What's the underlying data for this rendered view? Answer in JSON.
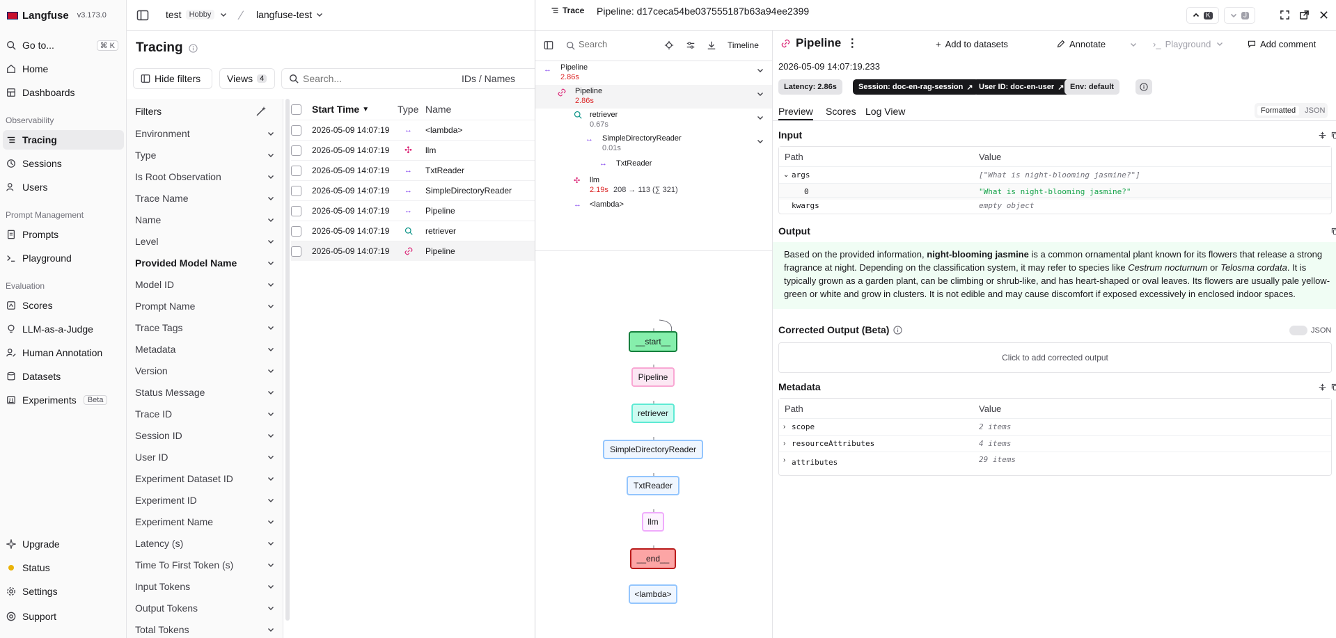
{
  "app": {
    "brand": "Langfuse",
    "version": "v3.173.0"
  },
  "sidebar": {
    "goto": "Go to...",
    "goto_kbd": "⌘ K",
    "home": "Home",
    "dashboards": "Dashboards",
    "section_observability": "Observability",
    "tracing": "Tracing",
    "sessions": "Sessions",
    "users": "Users",
    "section_prompt": "Prompt Management",
    "prompts": "Prompts",
    "playground": "Playground",
    "section_eval": "Evaluation",
    "scores": "Scores",
    "llm_judge": "LLM-as-a-Judge",
    "human_annotation": "Human Annotation",
    "datasets": "Datasets",
    "experiments": "Experiments",
    "experiments_badge": "Beta",
    "upgrade": "Upgrade",
    "status": "Status",
    "settings": "Settings",
    "support": "Support"
  },
  "topbar": {
    "org": "test",
    "plan": "Hobby",
    "project": "langfuse-test"
  },
  "main": {
    "title": "Tracing",
    "hide_filters": "Hide filters",
    "views": "Views",
    "views_count": "4",
    "search_placeholder": "Search...",
    "search_mode": "IDs / Names",
    "filters_title": "Filters",
    "filters": [
      "Environment",
      "Type",
      "Is Root Observation",
      "Trace Name",
      "Name",
      "Level",
      "Provided Model Name",
      "Model ID",
      "Prompt Name",
      "Trace Tags",
      "Metadata",
      "Version",
      "Status Message",
      "Trace ID",
      "Session ID",
      "User ID",
      "Experiment Dataset ID",
      "Experiment ID",
      "Experiment Name",
      "Latency (s)",
      "Time To First Token (s)",
      "Input Tokens",
      "Output Tokens",
      "Total Tokens"
    ],
    "columns": {
      "start_time": "Start Time",
      "type": "Type",
      "name": "Name"
    },
    "rows": [
      {
        "time": "2026-05-09 14:07:19",
        "type_icon": "span-icon",
        "name": "<lambda>"
      },
      {
        "time": "2026-05-09 14:07:19",
        "type_icon": "generation-icon",
        "name": "llm"
      },
      {
        "time": "2026-05-09 14:07:19",
        "type_icon": "span-icon",
        "name": "TxtReader"
      },
      {
        "time": "2026-05-09 14:07:19",
        "type_icon": "span-icon",
        "name": "SimpleDirectoryReader"
      },
      {
        "time": "2026-05-09 14:07:19",
        "type_icon": "span-icon",
        "name": "Pipeline"
      },
      {
        "time": "2026-05-09 14:07:19",
        "type_icon": "retriever-icon",
        "name": "retriever"
      },
      {
        "time": "2026-05-09 14:07:19",
        "type_icon": "chain-icon",
        "name": "Pipeline"
      }
    ]
  },
  "trace": {
    "label": "Trace",
    "title": "Pipeline: d17ceca54be037555187b63a94ee2399",
    "kbd_prev": "K",
    "kbd_next": "J",
    "tree_search_placeholder": "Search",
    "timeline": "Timeline",
    "tree": [
      {
        "name": "Pipeline",
        "latency": "2.86s"
      },
      {
        "name": "Pipeline",
        "latency": "2.86s"
      },
      {
        "name": "retriever",
        "latency": "0.67s"
      },
      {
        "name": "SimpleDirectoryReader",
        "latency": "0.01s"
      },
      {
        "name": "TxtReader"
      },
      {
        "name": "llm",
        "latency": "2.19s",
        "tokens": "208 → 113 (∑ 321)"
      },
      {
        "name": "<lambda>"
      }
    ],
    "graph": [
      "__start__",
      "Pipeline",
      "retriever",
      "SimpleDirectoryReader",
      "TxtReader",
      "llm",
      "__end__",
      "<lambda>"
    ]
  },
  "detail": {
    "title": "Pipeline",
    "add_to_datasets": "Add to datasets",
    "annotate": "Annotate",
    "playground": "Playground",
    "add_comment": "Add comment",
    "timestamp": "2026-05-09 14:07:19.233",
    "latency": "Latency: 2.86s",
    "session": "Session: doc-en-rag-session",
    "user": "User ID: doc-en-user",
    "env": "Env: default",
    "tabs": [
      "Preview",
      "Scores",
      "Log View"
    ],
    "format_formatted": "Formatted",
    "format_json": "JSON",
    "input_label": "Input",
    "path": "Path",
    "value": "Value",
    "input_rows": [
      {
        "path": "args",
        "value": "[\"What is night-blooming jasmine?\"]"
      },
      {
        "path": "0",
        "value": "\"What is night-blooming jasmine?\""
      },
      {
        "path": "kwargs",
        "value": "empty object"
      }
    ],
    "output_label": "Output",
    "output_p1": "Based on the provided information, ",
    "output_b1": "night-blooming jasmine",
    "output_p2": " is a common ornamental plant known for its flowers that release a strong fragrance at night. Depending on the classification system, it may refer to species like ",
    "output_i1": "Cestrum nocturnum",
    "output_p3": " or ",
    "output_i2": "Telosma cordata",
    "output_p4": ". It is typically grown as a garden plant, can be climbing or shrub-like, and has heart-shaped or oval leaves. Its flowers are usually pale yellow-green or white and grow in clusters. It is not edible and may cause discomfort if exposed excessively in enclosed indoor spaces.",
    "corrected_label": "Corrected Output (Beta)",
    "corrected_json": "JSON",
    "corrected_placeholder": "Click to add corrected output",
    "metadata_label": "Metadata",
    "metadata_rows": [
      {
        "path": "scope",
        "value": "2 items"
      },
      {
        "path": "resourceAttributes",
        "value": "4 items"
      },
      {
        "path": "attributes",
        "value": "29 items"
      }
    ]
  },
  "colors": {
    "latency_red": "#dc2626",
    "output_bg": "#f0fdf4",
    "start_node": "#86efac",
    "end_node": "#fca5a5",
    "pipeline_node": "#fce7f3",
    "retriever_node": "#ccfbf1",
    "span_node": "#eff6ff",
    "llm_node": "#fdf4ff"
  }
}
